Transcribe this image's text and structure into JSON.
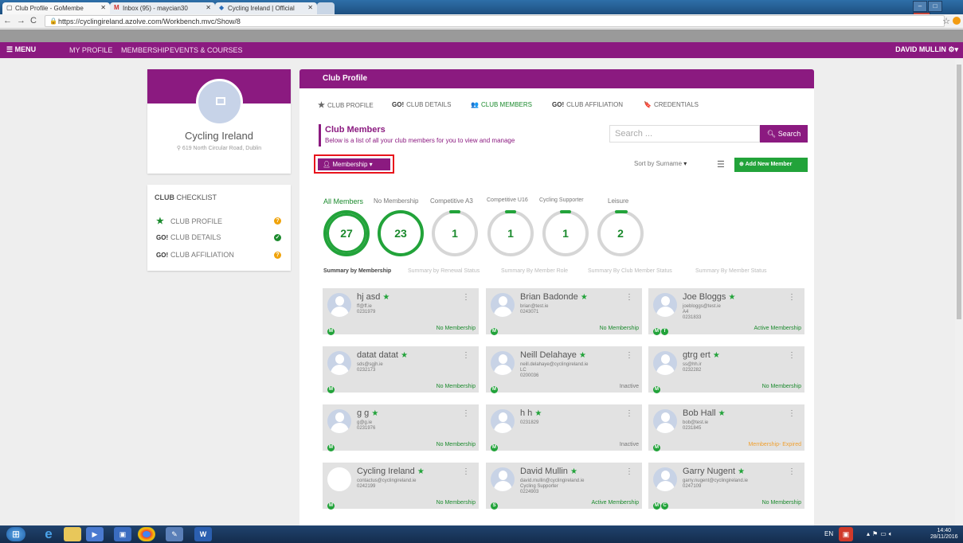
{
  "browser": {
    "tabs": [
      {
        "label": "Club Profile - GoMembe"
      },
      {
        "label": "Inbox (95) - maycian30"
      },
      {
        "label": "Cycling Ireland | Official"
      }
    ],
    "url": "https://cyclingireland.azolve.com/Workbench.mvc/Show/8"
  },
  "topnav": {
    "menu": "MENU",
    "links": [
      "MY PROFILE",
      "MEMBERSHIP",
      "EVENTS & COURSES"
    ],
    "user": "DAVID MULLIN"
  },
  "club": {
    "name": "Cycling Ireland",
    "address": "619 North Circular Road, Dublin"
  },
  "checklist": {
    "title_bold": "CLUB",
    "title_rest": " CHECKLIST",
    "items": [
      {
        "icon": "★",
        "label": "CLUB PROFILE"
      },
      {
        "icon": "GO!",
        "label": "CLUB DETAILS"
      },
      {
        "icon": "GO!",
        "label": "CLUB AFFILIATION"
      }
    ]
  },
  "panel": {
    "title": "Club Profile",
    "subtabs": [
      {
        "icon": "★",
        "label": "CLUB PROFILE"
      },
      {
        "icon": "GO!",
        "label": "CLUB DETAILS"
      },
      {
        "icon": "👥",
        "label": "CLUB MEMBERS"
      },
      {
        "icon": "GO!",
        "label": "CLUB AFFILIATION"
      },
      {
        "icon": "🔖",
        "label": "CREDENTIALS"
      }
    ],
    "section_title": "Club Members",
    "section_sub": "Below is a list of all your club members for you to view and manage",
    "search_placeholder": "Search ...",
    "search_button": "Search",
    "membership_button": "Membership",
    "sort_label": "Sort by Surname",
    "add_button": "Add New Member",
    "filters": [
      {
        "label": "All Members",
        "count": "27"
      },
      {
        "label": "No Membership",
        "count": "23"
      },
      {
        "label": "Competitive A3",
        "count": "1"
      },
      {
        "label": "Competitive U16",
        "count": "1"
      },
      {
        "label": "Cycling Supporter",
        "count": "1"
      },
      {
        "label": "Leisure",
        "count": "2"
      }
    ],
    "summary_tabs": [
      "Summary by Membership",
      "Summary by Renewal Status",
      "Summary By Member Role",
      "Summary By Club Member Status",
      "Summary By Member Status"
    ]
  },
  "members": [
    {
      "name": "hj asd",
      "lines": [
        "ff@ff.ie",
        "0231979"
      ],
      "badges": [
        "M"
      ],
      "status": "No Membership"
    },
    {
      "name": "Brian Badonde",
      "lines": [
        "brian@test.ie",
        "0243071"
      ],
      "badges": [
        "M"
      ],
      "status": "No Membership"
    },
    {
      "name": "Joe Bloggs",
      "lines": [
        "joebloggs@test.ie",
        "A4",
        "0231833"
      ],
      "badges": [
        "M",
        "T"
      ],
      "status": "Active Membership"
    },
    {
      "name": "datat datat",
      "lines": [
        "sds@sgjh.ie",
        "0232173"
      ],
      "badges": [
        "M"
      ],
      "status": "No Membership"
    },
    {
      "name": "Neill Delahaye",
      "lines": [
        "neill.delahaye@cyclingireland.ie",
        "LC",
        "0200036"
      ],
      "badges": [
        "M"
      ],
      "status": "Inactive"
    },
    {
      "name": "gtrg ert",
      "lines": [
        "ss@hh.ir",
        "0232282"
      ],
      "badges": [
        "M"
      ],
      "status": "No Membership"
    },
    {
      "name": "g g",
      "lines": [
        "g@g.ie",
        "0231976"
      ],
      "badges": [
        "M"
      ],
      "status": "No Membership"
    },
    {
      "name": "h h",
      "lines": [
        "0231829"
      ],
      "badges": [
        "M"
      ],
      "status": "Inactive"
    },
    {
      "name": "Bob Hall",
      "lines": [
        "bob@test.ie",
        "0231845"
      ],
      "badges": [
        "M"
      ],
      "status": "Membership- Expired"
    },
    {
      "name": "Cycling Ireland",
      "lines": [
        "contactus@cyclingireland.ie",
        "0242199"
      ],
      "badges": [
        "M"
      ],
      "status": "No Membership"
    },
    {
      "name": "David Mullin",
      "lines": [
        "david.mullin@cyclingireland.ie",
        "Cycling Supporter",
        "0224903"
      ],
      "badges": [
        "S"
      ],
      "status": "Active Membership"
    },
    {
      "name": "Garry Nugent",
      "lines": [
        "garry.nugent@cyclingireland.ie",
        "0247109"
      ],
      "badges": [
        "M",
        "C"
      ],
      "status": "No Membership"
    }
  ],
  "taskbar": {
    "lang": "EN",
    "time": "14:40",
    "date": "28/11/2016"
  }
}
